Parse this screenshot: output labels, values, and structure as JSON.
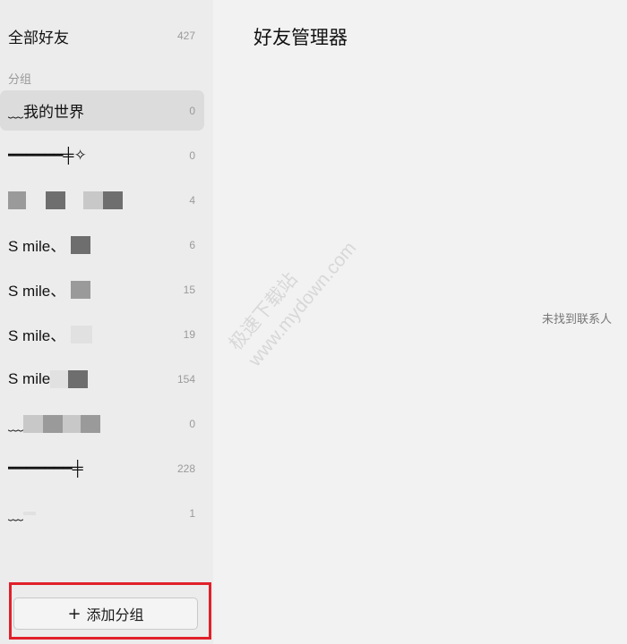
{
  "sidebar": {
    "all_friends": {
      "label": "全部好友",
      "count": "427"
    },
    "section_label": "分组",
    "groups": [
      {
        "name": "﹏我的世界",
        "count": "0"
      },
      {
        "name": "━━━━━━╪✧",
        "count": "0"
      },
      {
        "name": "",
        "count": "4"
      },
      {
        "name": "S mile、",
        "count": "6"
      },
      {
        "name": "S mile、",
        "count": "15"
      },
      {
        "name": "S mile、",
        "count": "19"
      },
      {
        "name": "S mile",
        "count": "154"
      },
      {
        "name": "﹏",
        "count": "0"
      },
      {
        "name": "━━━━━━━╪",
        "count": "228"
      },
      {
        "name": "﹏",
        "count": "1"
      }
    ],
    "add_group_button": {
      "icon": "+",
      "label": "添加分组"
    }
  },
  "main": {
    "title": "好友管理器",
    "empty_message": "未找到联系人"
  },
  "watermark": {
    "line1": "极速下载站",
    "line2": "www.mydown.com"
  },
  "colors": {
    "highlight_border": "#e0202a",
    "sidebar_bg": "#ececec",
    "main_bg": "#f2f2f2",
    "active_item": "#dcdcdc"
  }
}
